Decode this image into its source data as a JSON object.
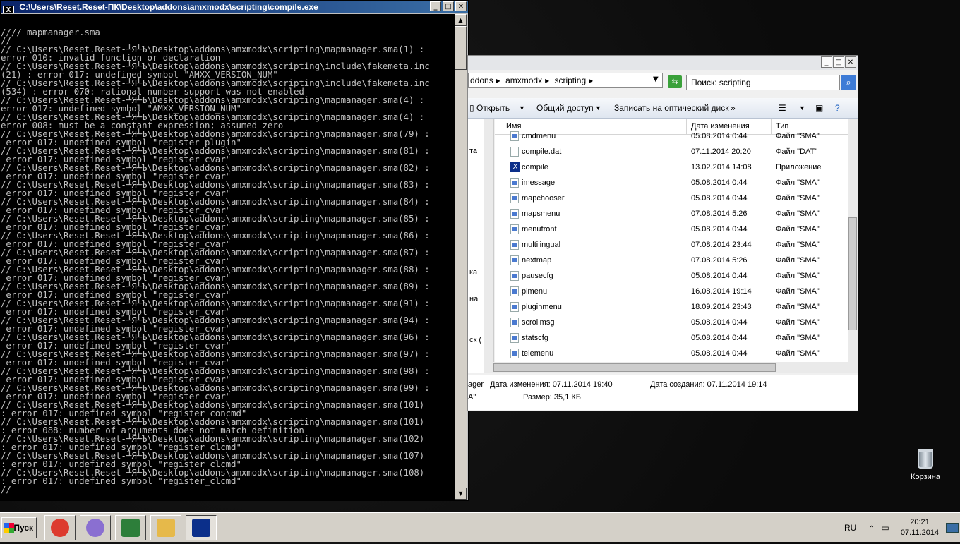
{
  "console": {
    "title": "C:\\Users\\Reset.Reset-ПК\\Desktop\\addons\\amxmodx\\scripting\\compile.exe",
    "lines": [
      "",
      "//// mapmanager.sma",
      "//",
      "// C:\\Users\\Reset.Reset-╨Я╨Ъ\\Desktop\\addons\\amxmodx\\scripting\\mapmanager.sma(1) :",
      "error 010: invalid function or declaration",
      "// C:\\Users\\Reset.Reset-╨Я╨Ъ\\Desktop\\addons\\amxmodx\\scripting\\include\\fakemeta.inc",
      "(21) : error 017: undefined symbol \"AMXX_VERSION_NUM\"",
      "// C:\\Users\\Reset.Reset-╨Я╨Ъ\\Desktop\\addons\\amxmodx\\scripting\\include\\fakemeta.inc",
      "(534) : error 070: rational number support was not enabled",
      "// C:\\Users\\Reset.Reset-╨Я╨Ъ\\Desktop\\addons\\amxmodx\\scripting\\mapmanager.sma(4) :",
      "error 017: undefined symbol \"AMXX_VERSION_NUM\"",
      "// C:\\Users\\Reset.Reset-╨Я╨Ъ\\Desktop\\addons\\amxmodx\\scripting\\mapmanager.sma(4) :",
      "error 008: must be a constant expression; assumed zero",
      "// C:\\Users\\Reset.Reset-╨Я╨Ъ\\Desktop\\addons\\amxmodx\\scripting\\mapmanager.sma(79) :",
      " error 017: undefined symbol \"register_plugin\"",
      "// C:\\Users\\Reset.Reset-╨Я╨Ъ\\Desktop\\addons\\amxmodx\\scripting\\mapmanager.sma(81) :",
      " error 017: undefined symbol \"register_cvar\"",
      "// C:\\Users\\Reset.Reset-╨Я╨Ъ\\Desktop\\addons\\amxmodx\\scripting\\mapmanager.sma(82) :",
      " error 017: undefined symbol \"register_cvar\"",
      "// C:\\Users\\Reset.Reset-╨Я╨Ъ\\Desktop\\addons\\amxmodx\\scripting\\mapmanager.sma(83) :",
      " error 017: undefined symbol \"register_cvar\"",
      "// C:\\Users\\Reset.Reset-╨Я╨Ъ\\Desktop\\addons\\amxmodx\\scripting\\mapmanager.sma(84) :",
      " error 017: undefined symbol \"register_cvar\"",
      "// C:\\Users\\Reset.Reset-╨Я╨Ъ\\Desktop\\addons\\amxmodx\\scripting\\mapmanager.sma(85) :",
      " error 017: undefined symbol \"register_cvar\"",
      "// C:\\Users\\Reset.Reset-╨Я╨Ъ\\Desktop\\addons\\amxmodx\\scripting\\mapmanager.sma(86) :",
      " error 017: undefined symbol \"register_cvar\"",
      "// C:\\Users\\Reset.Reset-╨Я╨Ъ\\Desktop\\addons\\amxmodx\\scripting\\mapmanager.sma(87) :",
      " error 017: undefined symbol \"register_cvar\"",
      "// C:\\Users\\Reset.Reset-╨Я╨Ъ\\Desktop\\addons\\amxmodx\\scripting\\mapmanager.sma(88) :",
      " error 017: undefined symbol \"register_cvar\"",
      "// C:\\Users\\Reset.Reset-╨Я╨Ъ\\Desktop\\addons\\amxmodx\\scripting\\mapmanager.sma(89) :",
      " error 017: undefined symbol \"register_cvar\"",
      "// C:\\Users\\Reset.Reset-╨Я╨Ъ\\Desktop\\addons\\amxmodx\\scripting\\mapmanager.sma(91) :",
      " error 017: undefined symbol \"register_cvar\"",
      "// C:\\Users\\Reset.Reset-╨Я╨Ъ\\Desktop\\addons\\amxmodx\\scripting\\mapmanager.sma(94) :",
      " error 017: undefined symbol \"register_cvar\"",
      "// C:\\Users\\Reset.Reset-╨Я╨Ъ\\Desktop\\addons\\amxmodx\\scripting\\mapmanager.sma(96) :",
      " error 017: undefined symbol \"register_cvar\"",
      "// C:\\Users\\Reset.Reset-╨Я╨Ъ\\Desktop\\addons\\amxmodx\\scripting\\mapmanager.sma(97) :",
      " error 017: undefined symbol \"register_cvar\"",
      "// C:\\Users\\Reset.Reset-╨Я╨Ъ\\Desktop\\addons\\amxmodx\\scripting\\mapmanager.sma(98) :",
      " error 017: undefined symbol \"register_cvar\"",
      "// C:\\Users\\Reset.Reset-╨Я╨Ъ\\Desktop\\addons\\amxmodx\\scripting\\mapmanager.sma(99) :",
      " error 017: undefined symbol \"register_cvar\"",
      "// C:\\Users\\Reset.Reset-╨Я╨Ъ\\Desktop\\addons\\amxmodx\\scripting\\mapmanager.sma(101)",
      ": error 017: undefined symbol \"register_concmd\"",
      "// C:\\Users\\Reset.Reset-╨Я╨Ъ\\Desktop\\addons\\amxmodx\\scripting\\mapmanager.sma(101)",
      ": error 088: number of arguments does not match definition",
      "// C:\\Users\\Reset.Reset-╨Я╨Ъ\\Desktop\\addons\\amxmodx\\scripting\\mapmanager.sma(102)",
      ": error 017: undefined symbol \"register_clcmd\"",
      "// C:\\Users\\Reset.Reset-╨Я╨Ъ\\Desktop\\addons\\amxmodx\\scripting\\mapmanager.sma(107)",
      ": error 017: undefined symbol \"register_clcmd\"",
      "// C:\\Users\\Reset.Reset-╨Я╨Ъ\\Desktop\\addons\\amxmodx\\scripting\\mapmanager.sma(108)",
      ": error 017: undefined symbol \"register_clcmd\"",
      "//"
    ]
  },
  "explorer": {
    "breadcrumb": [
      "ddons",
      "amxmodx",
      "scripting"
    ],
    "search_placeholder": "Поиск: scripting",
    "toolbar": {
      "open": "Открыть",
      "share": "Общий доступ",
      "burn": "Записать на оптический диск",
      "more": "»"
    },
    "nav_fragments": [
      "та",
      "ка",
      "на",
      "ск ("
    ],
    "columns": {
      "name": "Имя",
      "date": "Дата изменения",
      "type": "Тип"
    },
    "files": [
      {
        "name": "cmdmenu",
        "date": "05.08.2014 0:44",
        "type": "Файл \"SMA\"",
        "icon": "sma"
      },
      {
        "name": "compile.dat",
        "date": "07.11.2014 20:20",
        "type": "Файл \"DAT\"",
        "icon": "dat"
      },
      {
        "name": "compile",
        "date": "13.02.2014 14:08",
        "type": "Приложение",
        "icon": "app"
      },
      {
        "name": "imessage",
        "date": "05.08.2014 0:44",
        "type": "Файл \"SMA\"",
        "icon": "sma"
      },
      {
        "name": "mapchooser",
        "date": "05.08.2014 0:44",
        "type": "Файл \"SMA\"",
        "icon": "sma"
      },
      {
        "name": "mapsmenu",
        "date": "07.08.2014 5:26",
        "type": "Файл \"SMA\"",
        "icon": "sma"
      },
      {
        "name": "menufront",
        "date": "05.08.2014 0:44",
        "type": "Файл \"SMA\"",
        "icon": "sma"
      },
      {
        "name": "multilingual",
        "date": "07.08.2014 23:44",
        "type": "Файл \"SMA\"",
        "icon": "sma"
      },
      {
        "name": "nextmap",
        "date": "07.08.2014 5:26",
        "type": "Файл \"SMA\"",
        "icon": "sma"
      },
      {
        "name": "pausecfg",
        "date": "05.08.2014 0:44",
        "type": "Файл \"SMA\"",
        "icon": "sma"
      },
      {
        "name": "plmenu",
        "date": "16.08.2014 19:14",
        "type": "Файл \"SMA\"",
        "icon": "sma"
      },
      {
        "name": "pluginmenu",
        "date": "18.09.2014 23:43",
        "type": "Файл \"SMA\"",
        "icon": "sma"
      },
      {
        "name": "scrollmsg",
        "date": "05.08.2014 0:44",
        "type": "Файл \"SMA\"",
        "icon": "sma"
      },
      {
        "name": "statscfg",
        "date": "05.08.2014 0:44",
        "type": "Файл \"SMA\"",
        "icon": "sma"
      },
      {
        "name": "telemenu",
        "date": "05.08.2014 0:44",
        "type": "Файл \"SMA\"",
        "icon": "sma"
      }
    ],
    "details": {
      "name_fragment": "ager",
      "type_fragment": "A\"",
      "modified": "Дата изменения: 07.11.2014 19:40",
      "created": "Дата создания: 07.11.2014 19:14",
      "size": "Размер: 35,1 КБ"
    }
  },
  "desktop": {
    "recycle_bin": "Корзина"
  },
  "taskbar": {
    "start": "Пуск",
    "apps": [
      {
        "name": "chrome",
        "color": "#dd3b2f"
      },
      {
        "name": "purple-app",
        "color": "#8a6fd1"
      },
      {
        "name": "network",
        "color": "#2d7e3a"
      },
      {
        "name": "explorer",
        "color": "#e6b94a"
      },
      {
        "name": "compile",
        "color": "#0b2f8a"
      }
    ],
    "lang": "RU",
    "time": "20:21",
    "date": "07.11.2014"
  }
}
